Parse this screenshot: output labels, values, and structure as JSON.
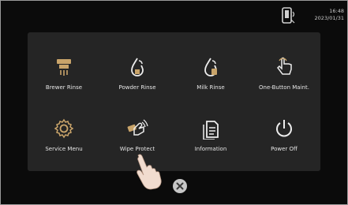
{
  "status": {
    "time": "16:48",
    "date": "2023/01/31",
    "connection_icon": "phone-connection-icon"
  },
  "menu": {
    "items": [
      {
        "label": "Brewer Rinse",
        "icon": "brewer-rinse-icon"
      },
      {
        "label": "Powder Rinse",
        "icon": "powder-rinse-icon"
      },
      {
        "label": "Milk Rinse",
        "icon": "milk-rinse-icon"
      },
      {
        "label": "One-Button Maint.",
        "icon": "touch-hand-icon"
      },
      {
        "label": "Service Menu",
        "icon": "gear-icon"
      },
      {
        "label": "Wipe Protect",
        "icon": "wipe-protect-icon"
      },
      {
        "label": "Information",
        "icon": "document-icon"
      },
      {
        "label": "Power Off",
        "icon": "power-icon"
      }
    ]
  },
  "close": {
    "icon": "close-icon"
  },
  "colors": {
    "screen": "#0b0b0b",
    "panel": "#252525",
    "text": "#e6e6e6",
    "icon_gold": "#c9a46a"
  }
}
